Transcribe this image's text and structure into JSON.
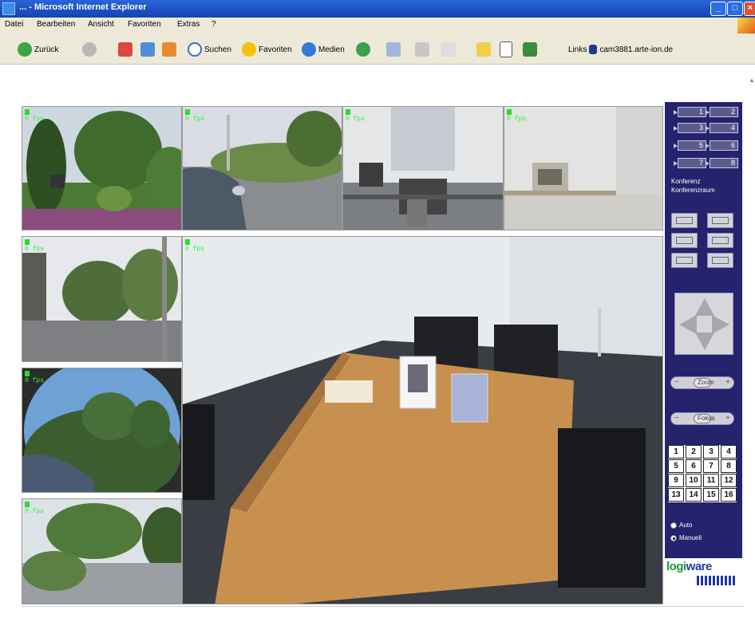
{
  "window": {
    "title": "... - Microsoft Internet Explorer"
  },
  "menu": [
    "Datei",
    "Bearbeiten",
    "Ansicht",
    "Favoriten",
    "Extras",
    "?"
  ],
  "toolbar": {
    "back": "Zurück",
    "search": "Suchen",
    "favorites": "Favoriten",
    "media": "Medien",
    "links_label": "Links",
    "address": "cam3881.arte-ion.de"
  },
  "cameras": {
    "indicator_label": "0 fps"
  },
  "panel": {
    "cam_buttons": [
      "1",
      "2",
      "3",
      "4",
      "5",
      "6",
      "7",
      "8"
    ],
    "caption_line1": "Konferenz",
    "caption_line2": "Konferenzraum",
    "zoom_label": "Zoom",
    "focus_label": "Fokus",
    "numbers": [
      "1",
      "2",
      "3",
      "4",
      "5",
      "6",
      "7",
      "8",
      "9",
      "10",
      "11",
      "12",
      "13",
      "14",
      "15",
      "16"
    ],
    "radio_1": "Auto",
    "radio_2": "Manuell",
    "logo_part1": "logi",
    "logo_part2": "ware"
  },
  "colors": {
    "panel_bg": "#25236e",
    "indicator": "#23e02a",
    "titlebar": "#1c4fc4"
  }
}
